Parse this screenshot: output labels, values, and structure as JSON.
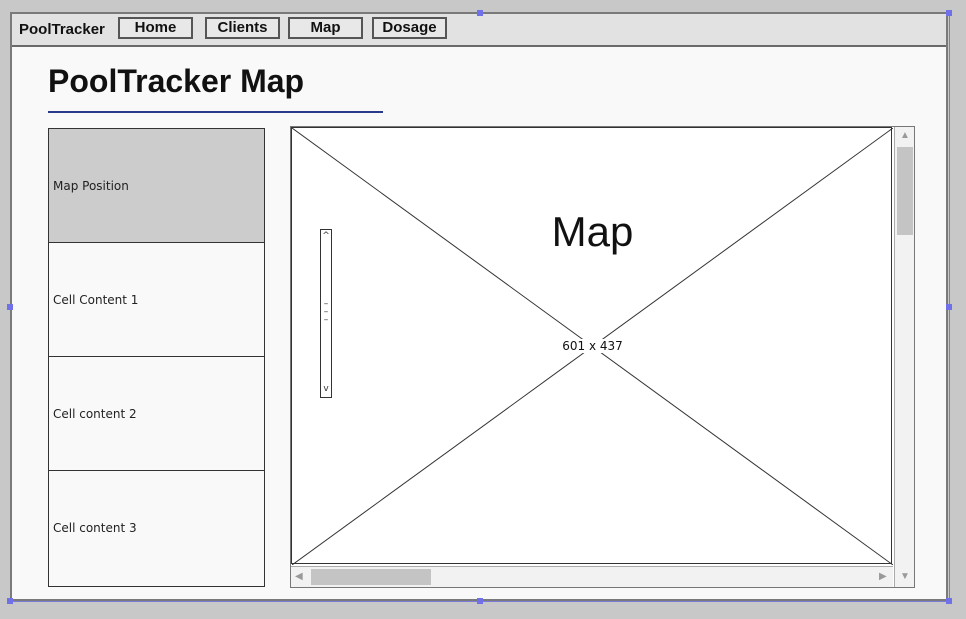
{
  "navbar": {
    "brand": "PoolTracker",
    "items": [
      {
        "label": "Home"
      },
      {
        "label": "Clients"
      },
      {
        "label": "Map"
      },
      {
        "label": "Dosage"
      }
    ]
  },
  "page": {
    "title": "PoolTracker Map"
  },
  "list": {
    "items": [
      {
        "label": "Map Position",
        "selected": true
      },
      {
        "label": "Cell Content 1",
        "selected": false
      },
      {
        "label": "Cell content 2",
        "selected": false
      },
      {
        "label": "Cell content 3",
        "selected": false
      }
    ]
  },
  "map": {
    "label": "Map",
    "dimensions": "601 x 437",
    "zoom": {
      "up_glyph": "^",
      "down_glyph": "v",
      "mark_glyph": "–"
    }
  },
  "scrollbars": {
    "up_arrow": "▲",
    "down_arrow": "▼",
    "left_arrow": "◀",
    "right_arrow": "▶"
  },
  "colors": {
    "selected_row": "#cccccc",
    "title_rule": "#2a3a8a",
    "selection_handle": "#7070e8"
  }
}
